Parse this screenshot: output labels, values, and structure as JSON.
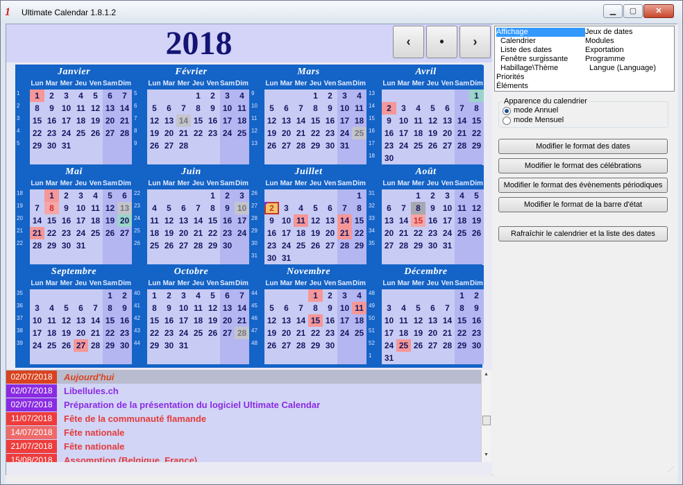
{
  "window": {
    "title": "Ultimate Calendar 1.8.1.2",
    "minimize_glyph": "▁",
    "maximize_glyph": "▢",
    "close_glyph": "✕"
  },
  "year": "2018",
  "nav": {
    "prev": "‹",
    "today": "•",
    "next": "›"
  },
  "weekdays": [
    "Lun",
    "Mar",
    "Mer",
    "Jeu",
    "Ven",
    "Sam",
    "Dim"
  ],
  "months": [
    {
      "name": "Janvier",
      "rows": [
        [
          "1",
          "1",
          "2",
          "3",
          "4",
          "5",
          "6",
          "7"
        ],
        [
          "2",
          "8",
          "9",
          "10",
          "11",
          "12",
          "13",
          "14"
        ],
        [
          "3",
          "15",
          "16",
          "17",
          "18",
          "19",
          "20",
          "21"
        ],
        [
          "4",
          "22",
          "23",
          "24",
          "25",
          "26",
          "27",
          "28"
        ],
        [
          "5",
          "29",
          "30",
          "31",
          "",
          "",
          "",
          ""
        ],
        [
          "",
          "",
          "",
          "",
          "",
          "",
          "",
          ""
        ]
      ],
      "marks": {
        "1": "ev"
      }
    },
    {
      "name": "Février",
      "rows": [
        [
          "5",
          "",
          "",
          "",
          "1",
          "2",
          "3",
          "4"
        ],
        [
          "6",
          "5",
          "6",
          "7",
          "8",
          "9",
          "10",
          "11"
        ],
        [
          "7",
          "12",
          "13",
          "14",
          "15",
          "16",
          "17",
          "18"
        ],
        [
          "8",
          "19",
          "20",
          "21",
          "22",
          "23",
          "24",
          "25"
        ],
        [
          "9",
          "26",
          "27",
          "28",
          "",
          "",
          "",
          ""
        ],
        [
          "",
          "",
          "",
          "",
          "",
          "",
          "",
          ""
        ]
      ],
      "marks": {
        "14": "grey"
      }
    },
    {
      "name": "Mars",
      "rows": [
        [
          "9",
          "",
          "",
          "",
          "1",
          "2",
          "3",
          "4"
        ],
        [
          "10",
          "5",
          "6",
          "7",
          "8",
          "9",
          "10",
          "11"
        ],
        [
          "11",
          "12",
          "13",
          "14",
          "15",
          "16",
          "17",
          "18"
        ],
        [
          "12",
          "19",
          "20",
          "21",
          "22",
          "23",
          "24",
          "25"
        ],
        [
          "13",
          "26",
          "27",
          "28",
          "29",
          "30",
          "31",
          ""
        ],
        [
          "",
          "",
          "",
          "",
          "",
          "",
          "",
          ""
        ]
      ],
      "marks": {
        "25": "grey"
      }
    },
    {
      "name": "Avril",
      "rows": [
        [
          "13",
          "",
          "",
          "",
          "",
          "",
          "",
          "1"
        ],
        [
          "14",
          "2",
          "3",
          "4",
          "5",
          "6",
          "7",
          "8"
        ],
        [
          "15",
          "9",
          "10",
          "11",
          "12",
          "13",
          "14",
          "15"
        ],
        [
          "16",
          "16",
          "17",
          "18",
          "19",
          "20",
          "21",
          "22"
        ],
        [
          "17",
          "23",
          "24",
          "25",
          "26",
          "27",
          "28",
          "29"
        ],
        [
          "18",
          "30",
          "",
          "",
          "",
          "",
          "",
          ""
        ]
      ],
      "marks": {
        "1": "cyan",
        "2": "ev"
      }
    },
    {
      "name": "Mai",
      "rows": [
        [
          "18",
          "",
          "1",
          "2",
          "3",
          "4",
          "5",
          "6"
        ],
        [
          "19",
          "7",
          "8",
          "9",
          "10",
          "11",
          "12",
          "13"
        ],
        [
          "20",
          "14",
          "15",
          "16",
          "17",
          "18",
          "19",
          "20"
        ],
        [
          "21",
          "21",
          "22",
          "23",
          "24",
          "25",
          "26",
          "27"
        ],
        [
          "22",
          "28",
          "29",
          "30",
          "31",
          "",
          "",
          ""
        ],
        [
          "",
          "",
          "",
          "",
          "",
          "",
          "",
          ""
        ]
      ],
      "marks": {
        "1": "ev",
        "8": "hol",
        "13": "grey",
        "20": "cyan",
        "21": "ev"
      }
    },
    {
      "name": "Juin",
      "rows": [
        [
          "22",
          "",
          "",
          "",
          "",
          "1",
          "2",
          "3"
        ],
        [
          "23",
          "4",
          "5",
          "6",
          "7",
          "8",
          "9",
          "10"
        ],
        [
          "24",
          "11",
          "12",
          "13",
          "14",
          "15",
          "16",
          "17"
        ],
        [
          "25",
          "18",
          "19",
          "20",
          "21",
          "22",
          "23",
          "24"
        ],
        [
          "26",
          "25",
          "26",
          "27",
          "28",
          "29",
          "30",
          ""
        ],
        [
          "",
          "",
          "",
          "",
          "",
          "",
          "",
          ""
        ]
      ],
      "marks": {
        "10": "grey"
      }
    },
    {
      "name": "Juillet",
      "rows": [
        [
          "26",
          "",
          "",
          "",
          "",
          "",
          "",
          "1"
        ],
        [
          "27",
          "2",
          "3",
          "4",
          "5",
          "6",
          "7",
          "8"
        ],
        [
          "28",
          "9",
          "10",
          "11",
          "12",
          "13",
          "14",
          "15"
        ],
        [
          "29",
          "16",
          "17",
          "18",
          "19",
          "20",
          "21",
          "22"
        ],
        [
          "30",
          "23",
          "24",
          "25",
          "26",
          "27",
          "28",
          "29"
        ],
        [
          "31",
          "30",
          "31",
          "",
          "",
          "",
          "",
          ""
        ]
      ],
      "marks": {
        "2": "today",
        "11": "ev",
        "14": "ev",
        "21": "ev"
      }
    },
    {
      "name": "Août",
      "rows": [
        [
          "31",
          "",
          "",
          "1",
          "2",
          "3",
          "4",
          "5"
        ],
        [
          "32",
          "6",
          "7",
          "8",
          "9",
          "10",
          "11",
          "12"
        ],
        [
          "33",
          "13",
          "14",
          "15",
          "16",
          "17",
          "18",
          "19"
        ],
        [
          "34",
          "20",
          "21",
          "22",
          "23",
          "24",
          "25",
          "26"
        ],
        [
          "35",
          "27",
          "28",
          "29",
          "30",
          "31",
          "",
          ""
        ],
        [
          "",
          "",
          "",
          "",
          "",
          "",
          "",
          ""
        ]
      ],
      "marks": {
        "8": "sel",
        "15": "hol"
      }
    },
    {
      "name": "Septembre",
      "rows": [
        [
          "35",
          "",
          "",
          "",
          "",
          "",
          "1",
          "2"
        ],
        [
          "36",
          "3",
          "4",
          "5",
          "6",
          "7",
          "8",
          "9"
        ],
        [
          "37",
          "10",
          "11",
          "12",
          "13",
          "14",
          "15",
          "16"
        ],
        [
          "38",
          "17",
          "18",
          "19",
          "20",
          "21",
          "22",
          "23"
        ],
        [
          "39",
          "24",
          "25",
          "26",
          "27",
          "28",
          "29",
          "30"
        ],
        [
          "",
          "",
          "",
          "",
          "",
          "",
          "",
          ""
        ]
      ],
      "marks": {
        "27": "ev"
      }
    },
    {
      "name": "Octobre",
      "rows": [
        [
          "40",
          "1",
          "2",
          "3",
          "4",
          "5",
          "6",
          "7"
        ],
        [
          "41",
          "8",
          "9",
          "10",
          "11",
          "12",
          "13",
          "14"
        ],
        [
          "42",
          "15",
          "16",
          "17",
          "18",
          "19",
          "20",
          "21"
        ],
        [
          "43",
          "22",
          "23",
          "24",
          "25",
          "26",
          "27",
          "28"
        ],
        [
          "44",
          "29",
          "30",
          "31",
          "",
          "",
          "",
          ""
        ],
        [
          "",
          "",
          "",
          "",
          "",
          "",
          "",
          ""
        ]
      ],
      "marks": {
        "28": "grey"
      }
    },
    {
      "name": "Novembre",
      "rows": [
        [
          "44",
          "",
          "",
          "",
          "1",
          "2",
          "3",
          "4"
        ],
        [
          "45",
          "5",
          "6",
          "7",
          "8",
          "9",
          "10",
          "11"
        ],
        [
          "46",
          "12",
          "13",
          "14",
          "15",
          "16",
          "17",
          "18"
        ],
        [
          "47",
          "19",
          "20",
          "21",
          "22",
          "23",
          "24",
          "25"
        ],
        [
          "48",
          "26",
          "27",
          "28",
          "29",
          "30",
          "",
          ""
        ],
        [
          "",
          "",
          "",
          "",
          "",
          "",
          "",
          ""
        ]
      ],
      "marks": {
        "1": "ev",
        "11": "ev",
        "15": "ev"
      }
    },
    {
      "name": "Décembre",
      "rows": [
        [
          "48",
          "",
          "",
          "",
          "",
          "",
          "1",
          "2"
        ],
        [
          "49",
          "3",
          "4",
          "5",
          "6",
          "7",
          "8",
          "9"
        ],
        [
          "50",
          "10",
          "11",
          "12",
          "13",
          "14",
          "15",
          "16"
        ],
        [
          "51",
          "17",
          "18",
          "19",
          "20",
          "21",
          "22",
          "23"
        ],
        [
          "52",
          "24",
          "25",
          "26",
          "27",
          "28",
          "29",
          "30"
        ],
        [
          "1",
          "31",
          "",
          "",
          "",
          "",
          "",
          ""
        ]
      ],
      "marks": {
        "25": "ev"
      }
    }
  ],
  "events": [
    {
      "date": "02/07/2018",
      "text": "Aujourd'hui",
      "date_bg": "#d9431f",
      "color": "#d9431f",
      "italic": true,
      "row_bg": "#b9bccf"
    },
    {
      "date": "02/07/2018",
      "text": "Libellules.ch",
      "date_bg": "#8a2be2",
      "color": "#8a2be2"
    },
    {
      "date": "02/07/2018",
      "text": "Préparation de la présentation du logiciel Ultimate Calendar",
      "date_bg": "#8a2be2",
      "color": "#8a2be2"
    },
    {
      "date": "11/07/2018",
      "text": "Fête de la communauté flamande",
      "date_bg": "#ee3c3c",
      "color": "#e23b3b"
    },
    {
      "date": "14/07/2018",
      "text": "Fête nationale",
      "date_bg": "#ee6a6a",
      "color": "#e23b3b"
    },
    {
      "date": "21/07/2018",
      "text": "Fête nationale",
      "date_bg": "#ee3c3c",
      "color": "#e23b3b"
    },
    {
      "date": "15/08/2018",
      "text": "Assomption (Belgique, France)",
      "date_bg": "#ee3c3c",
      "color": "#e23b3b"
    }
  ],
  "menu": {
    "col1": [
      "Affichage",
      "Calendrier",
      "Liste des dates",
      "Fenêtre surgissante",
      "Habillage\\Thème",
      "Priorités",
      "Éléments"
    ],
    "col2": [
      "Jeux de dates",
      "Modules",
      "Exportation",
      "Programme",
      "Langue (Language)"
    ],
    "active": "Affichage"
  },
  "appearance": {
    "legend": "Apparence du calendrier",
    "option_annual": "mode Annuel",
    "option_monthly": "mode Mensuel",
    "selected": "annual"
  },
  "buttons": {
    "date_format": "Modifier le format des dates",
    "celebration_format": "Modifier le format des célébrations",
    "periodic_format": "Modifier le format des évènements périodiques",
    "statusbar_format": "Modifier le format de la barre d'état",
    "refresh": "Rafraîchir le calendrier et la liste des dates"
  }
}
